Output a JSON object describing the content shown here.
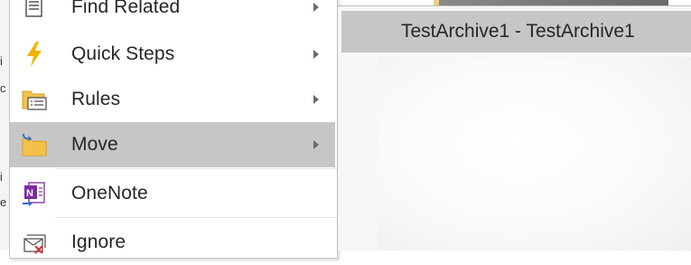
{
  "context_menu": {
    "items": [
      {
        "label": "Find Related",
        "icon": "find-related-icon",
        "has_submenu": true,
        "selected": false
      },
      {
        "label": "Quick Steps",
        "icon": "lightning-icon",
        "has_submenu": true,
        "selected": false
      },
      {
        "label": "Rules",
        "icon": "rules-icon",
        "has_submenu": true,
        "selected": false
      },
      {
        "label": "Move",
        "icon": "move-folder-icon",
        "has_submenu": true,
        "selected": true
      },
      {
        "label": "OneNote",
        "icon": "onenote-icon",
        "has_submenu": false,
        "selected": false
      },
      {
        "label": "Ignore",
        "icon": "ignore-icon",
        "has_submenu": false,
        "selected": false
      }
    ]
  },
  "move_submenu": {
    "items": [
      {
        "label": "TestArchive1 - TestArchive1",
        "selected": true
      }
    ]
  },
  "colors": {
    "menu_bg": "#ffffff",
    "selected_bg": "#c6c6c6",
    "text": "#262626",
    "lightning": "#f2b400",
    "folder": "#f3c04a",
    "onenote": "#7b2c9d",
    "arrow_blue": "#2f6fc2"
  }
}
